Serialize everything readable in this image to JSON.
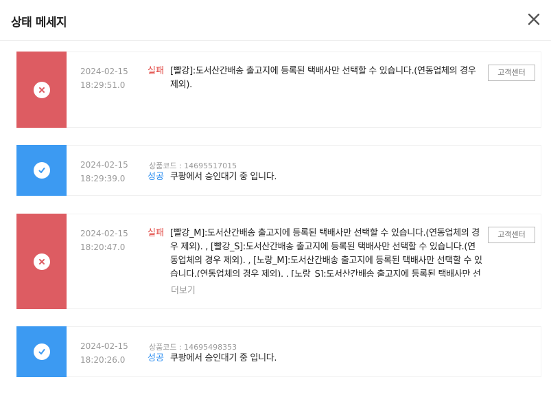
{
  "header": {
    "title": "상태 메세지",
    "close_icon": "close-icon"
  },
  "colors": {
    "fail_badge": "#dd5c62",
    "success_badge": "#3c9af2",
    "fail_text": "#e0443f",
    "success_text": "#2c8ef0"
  },
  "rows": [
    {
      "type": "fail",
      "date": "2024-02-15",
      "time": "18:29:51.0",
      "status": "실패",
      "message": "[빨강]:도서산간배송 출고지에 등록된 택배사만 선택할 수 있습니다.(연동업체의 경우 제외).",
      "button": "고객센터"
    },
    {
      "type": "success",
      "date": "2024-02-15",
      "time": "18:29:39.0",
      "code": "상품코드 : 14695517015",
      "status": "성공",
      "message": "쿠팡에서 승인대기 중 입니다."
    },
    {
      "type": "fail",
      "date": "2024-02-15",
      "time": "18:20:47.0",
      "status": "실패",
      "message": "[빨강_M]:도서산간배송 출고지에 등록된 택배사만 선택할 수 있습니다.(연동업체의 경우 제외). , [빨강_S]:도서산간배송 출고지에 등록된 택배사만 선택할 수 있습니다.(연동업체의 경우 제외). , [노랑_M]:도서산간배송 출고지에 등록된 택배사만 선택할 수 있습니다.(연동업체의 경우 제외). , [노랑_S]:도서산간배송 출고지에 등록된 택배사만 선택할 수 있습니다.(연동업체의 경우 제외).",
      "button": "고객센터",
      "more": "더보기"
    },
    {
      "type": "success",
      "date": "2024-02-15",
      "time": "18:20:26.0",
      "code": "상품코드 : 14695498353",
      "status": "성공",
      "message": "쿠팡에서 승인대기 중 입니다."
    }
  ]
}
